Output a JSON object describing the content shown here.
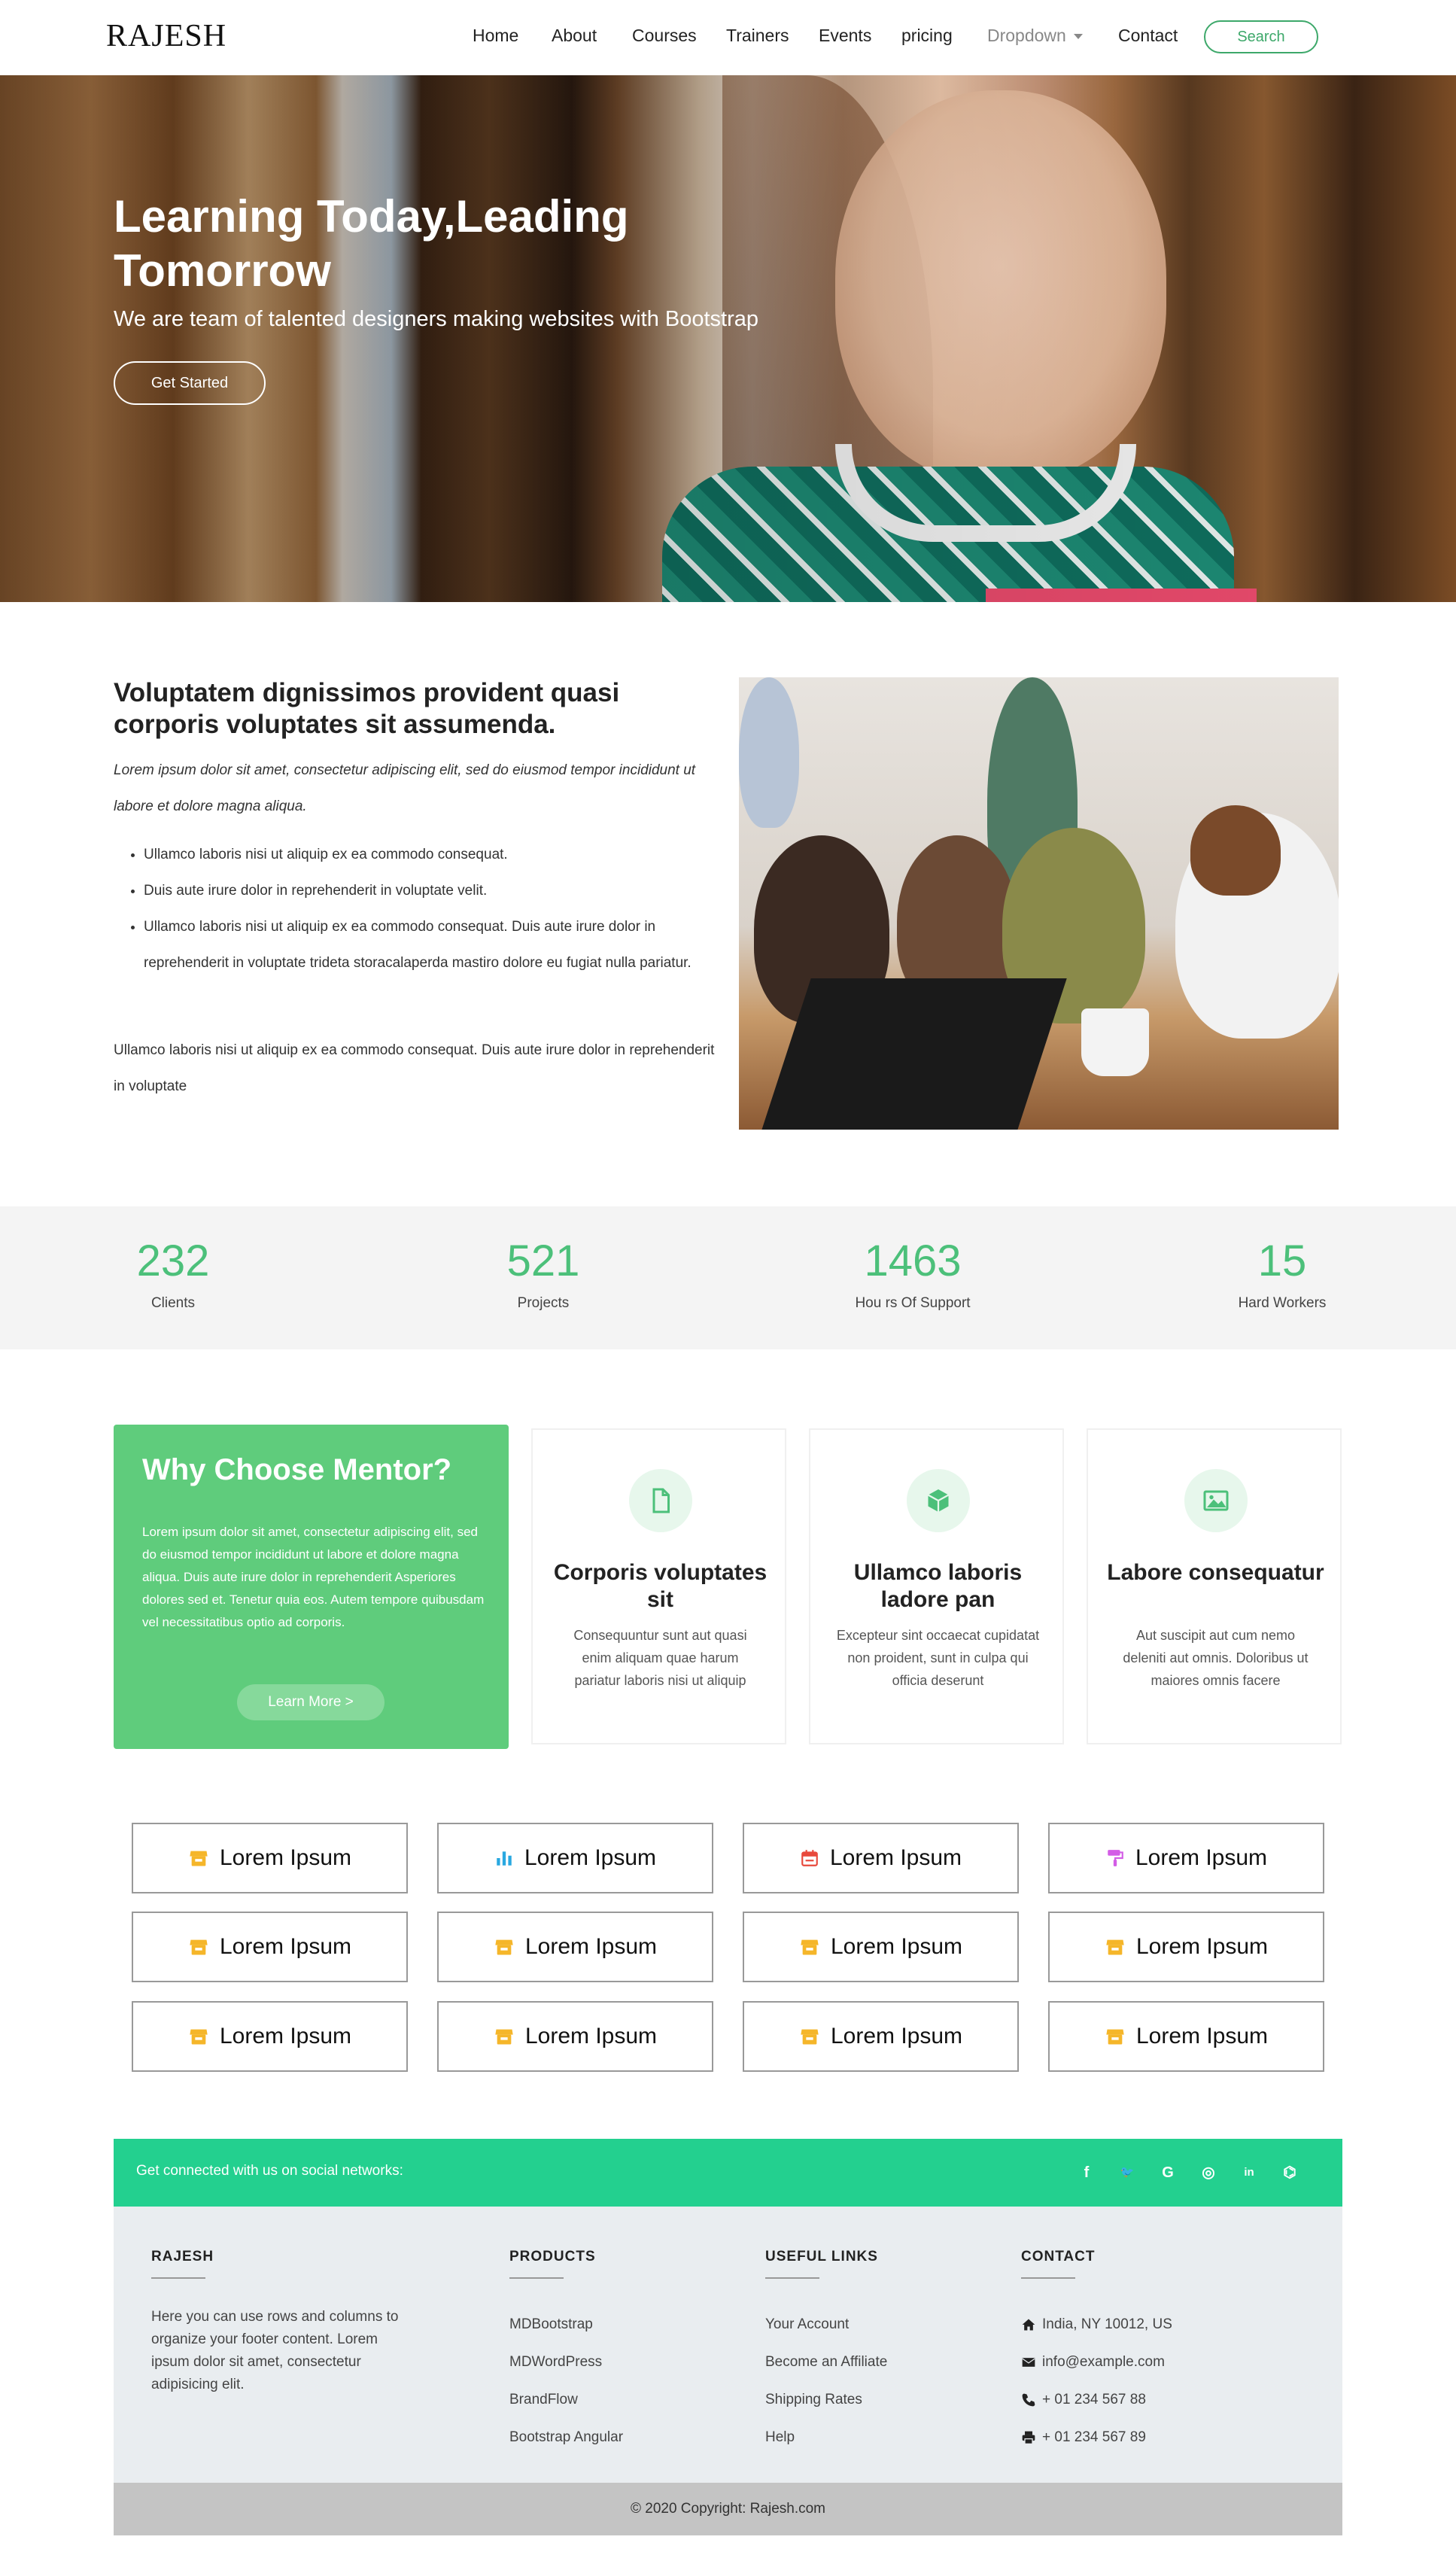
{
  "nav": {
    "brand": "RAJESH",
    "items": [
      {
        "label": "Home"
      },
      {
        "label": "About"
      },
      {
        "label": "Courses"
      },
      {
        "label": "Trainers"
      },
      {
        "label": "Events"
      },
      {
        "label": "pricing"
      },
      {
        "label": "Dropdown"
      },
      {
        "label": "Contact"
      }
    ],
    "search_label": "Search"
  },
  "hero": {
    "title": "Learning Today,Leading Tomorrow",
    "subtitle": "We are team of talented designers making websites with Bootstrap",
    "cta": "Get Started"
  },
  "about": {
    "title": "Voluptatem dignissimos provident quasi corporis voluptates sit assumenda.",
    "lead": "Lorem ipsum dolor sit amet, consectetur adipiscing elit, sed do eiusmod tempor incididunt ut labore et dolore magna aliqua.",
    "bullets": [
      "Ullamco laboris nisi ut aliquip ex ea commodo consequat.",
      "Duis aute irure dolor in reprehenderit in voluptate velit.",
      "Ullamco laboris nisi ut aliquip ex ea commodo consequat. Duis aute irure dolor in reprehenderit in voluptate trideta storacalaperda mastiro dolore eu fugiat nulla pariatur."
    ],
    "paragraph": "Ullamco laboris nisi ut aliquip ex ea commodo consequat. Duis aute irure dolor in reprehenderit in voluptate"
  },
  "stats": [
    {
      "value": "232",
      "label": "Clients"
    },
    {
      "value": "521",
      "label": "Projects"
    },
    {
      "value": "1463",
      "label": "Hou rs Of Support"
    },
    {
      "value": "15",
      "label": "Hard Workers"
    }
  ],
  "why": {
    "title": "Why Choose Mentor?",
    "text": "Lorem ipsum dolor sit amet, consectetur adipiscing elit, sed do eiusmod tempor incididunt ut labore et dolore magna aliqua. Duis aute irure dolor in reprehenderit Asperiores dolores sed et. Tenetur quia eos. Autem tempore quibusdam vel necessitatibus optio ad corporis.",
    "button": "Learn More >"
  },
  "features": [
    {
      "icon": "file-icon",
      "title": "Corporis voluptates sit",
      "text": "Consequuntur sunt aut quasi enim aliquam quae harum pariatur laboris nisi ut aliquip"
    },
    {
      "icon": "cube-icon",
      "title": "Ullamco laboris ladore pan",
      "text": "Excepteur sint occaecat cupidatat non proident, sunt in culpa qui officia deserunt"
    },
    {
      "icon": "image-icon",
      "title": "Labore consequatur",
      "text": "Aut suscipit aut cum nemo deleniti aut omnis. Doloribus ut maiores omnis facere"
    }
  ],
  "tiles": [
    {
      "label": "Lorem Ipsum",
      "icon": "store-icon",
      "color": "#f5b62a"
    },
    {
      "label": "Lorem Ipsum",
      "icon": "bar-chart-icon",
      "color": "#29a8e0"
    },
    {
      "label": "Lorem Ipsum",
      "icon": "calendar-icon",
      "color": "#e8493c"
    },
    {
      "label": "Lorem Ipsum",
      "icon": "paint-roller-icon",
      "color": "#d35de6"
    },
    {
      "label": "Lorem Ipsum",
      "icon": "store-icon",
      "color": "#f5b62a"
    },
    {
      "label": "Lorem Ipsum",
      "icon": "store-icon",
      "color": "#f5b62a"
    },
    {
      "label": "Lorem Ipsum",
      "icon": "store-icon",
      "color": "#f5b62a"
    },
    {
      "label": "Lorem Ipsum",
      "icon": "store-icon",
      "color": "#f5b62a"
    },
    {
      "label": "Lorem Ipsum",
      "icon": "store-icon",
      "color": "#f5b62a"
    },
    {
      "label": "Lorem Ipsum",
      "icon": "store-icon",
      "color": "#f5b62a"
    },
    {
      "label": "Lorem Ipsum",
      "icon": "store-icon",
      "color": "#f5b62a"
    },
    {
      "label": "Lorem Ipsum",
      "icon": "store-icon",
      "color": "#f5b62a"
    }
  ],
  "social": {
    "text": "Get connected with us on social networks:",
    "icons": [
      {
        "name": "facebook-icon",
        "glyph": "f"
      },
      {
        "name": "twitter-icon",
        "glyph": "🐦"
      },
      {
        "name": "google-icon",
        "glyph": "G"
      },
      {
        "name": "instagram-icon",
        "glyph": "◎"
      },
      {
        "name": "linkedin-icon",
        "glyph": "in"
      },
      {
        "name": "github-icon",
        "glyph": "⌬"
      }
    ]
  },
  "footer": {
    "brand": {
      "title": "RAJESH",
      "text": "Here you can use rows and columns to organize your footer content. Lorem ipsum dolor sit amet, consectetur adipisicing elit."
    },
    "products": {
      "title": "PRODUCTS",
      "links": [
        "MDBootstrap",
        "MDWordPress",
        "BrandFlow",
        "Bootstrap Angular"
      ]
    },
    "useful": {
      "title": "USEFUL LINKS",
      "links": [
        "Your Account",
        "Become an Affiliate",
        "Shipping Rates",
        "Help"
      ]
    },
    "contact": {
      "title": "CONTACT",
      "items": [
        {
          "icon": "home-icon",
          "text": "India, NY 10012, US"
        },
        {
          "icon": "envelope-icon",
          "text": "info@example.com"
        },
        {
          "icon": "phone-icon",
          "text": "+ 01 234 567 88"
        },
        {
          "icon": "printer-icon",
          "text": "+ 01 234 567 89"
        }
      ]
    },
    "copyright": "© 2020 Copyright: Rajesh.com"
  },
  "colors": {
    "accent": "#4cc07a",
    "why_card": "#5fcc7c",
    "social_bar": "#23d08f",
    "footer_bg": "#e9edf0"
  }
}
